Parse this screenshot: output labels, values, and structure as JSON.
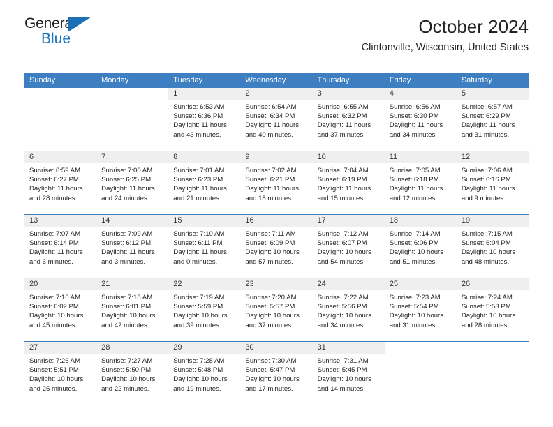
{
  "brand": {
    "name_top": "General",
    "name_bottom": "Blue",
    "accent_color": "#1d72b8"
  },
  "header": {
    "title": "October 2024",
    "location": "Clintonville, Wisconsin, United States"
  },
  "theme": {
    "header_bg": "#3d7fc1",
    "daynum_bg": "#efefef",
    "text": "#222222"
  },
  "weekday_headers": [
    "Sunday",
    "Monday",
    "Tuesday",
    "Wednesday",
    "Thursday",
    "Friday",
    "Saturday"
  ],
  "weeks": [
    [
      {
        "day": "",
        "lines": []
      },
      {
        "day": "",
        "lines": []
      },
      {
        "day": "1",
        "lines": [
          "Sunrise: 6:53 AM",
          "Sunset: 6:36 PM",
          "Daylight: 11 hours and 43 minutes."
        ]
      },
      {
        "day": "2",
        "lines": [
          "Sunrise: 6:54 AM",
          "Sunset: 6:34 PM",
          "Daylight: 11 hours and 40 minutes."
        ]
      },
      {
        "day": "3",
        "lines": [
          "Sunrise: 6:55 AM",
          "Sunset: 6:32 PM",
          "Daylight: 11 hours and 37 minutes."
        ]
      },
      {
        "day": "4",
        "lines": [
          "Sunrise: 6:56 AM",
          "Sunset: 6:30 PM",
          "Daylight: 11 hours and 34 minutes."
        ]
      },
      {
        "day": "5",
        "lines": [
          "Sunrise: 6:57 AM",
          "Sunset: 6:29 PM",
          "Daylight: 11 hours and 31 minutes."
        ]
      }
    ],
    [
      {
        "day": "6",
        "lines": [
          "Sunrise: 6:59 AM",
          "Sunset: 6:27 PM",
          "Daylight: 11 hours and 28 minutes."
        ]
      },
      {
        "day": "7",
        "lines": [
          "Sunrise: 7:00 AM",
          "Sunset: 6:25 PM",
          "Daylight: 11 hours and 24 minutes."
        ]
      },
      {
        "day": "8",
        "lines": [
          "Sunrise: 7:01 AM",
          "Sunset: 6:23 PM",
          "Daylight: 11 hours and 21 minutes."
        ]
      },
      {
        "day": "9",
        "lines": [
          "Sunrise: 7:02 AM",
          "Sunset: 6:21 PM",
          "Daylight: 11 hours and 18 minutes."
        ]
      },
      {
        "day": "10",
        "lines": [
          "Sunrise: 7:04 AM",
          "Sunset: 6:19 PM",
          "Daylight: 11 hours and 15 minutes."
        ]
      },
      {
        "day": "11",
        "lines": [
          "Sunrise: 7:05 AM",
          "Sunset: 6:18 PM",
          "Daylight: 11 hours and 12 minutes."
        ]
      },
      {
        "day": "12",
        "lines": [
          "Sunrise: 7:06 AM",
          "Sunset: 6:16 PM",
          "Daylight: 11 hours and 9 minutes."
        ]
      }
    ],
    [
      {
        "day": "13",
        "lines": [
          "Sunrise: 7:07 AM",
          "Sunset: 6:14 PM",
          "Daylight: 11 hours and 6 minutes."
        ]
      },
      {
        "day": "14",
        "lines": [
          "Sunrise: 7:09 AM",
          "Sunset: 6:12 PM",
          "Daylight: 11 hours and 3 minutes."
        ]
      },
      {
        "day": "15",
        "lines": [
          "Sunrise: 7:10 AM",
          "Sunset: 6:11 PM",
          "Daylight: 11 hours and 0 minutes."
        ]
      },
      {
        "day": "16",
        "lines": [
          "Sunrise: 7:11 AM",
          "Sunset: 6:09 PM",
          "Daylight: 10 hours and 57 minutes."
        ]
      },
      {
        "day": "17",
        "lines": [
          "Sunrise: 7:12 AM",
          "Sunset: 6:07 PM",
          "Daylight: 10 hours and 54 minutes."
        ]
      },
      {
        "day": "18",
        "lines": [
          "Sunrise: 7:14 AM",
          "Sunset: 6:06 PM",
          "Daylight: 10 hours and 51 minutes."
        ]
      },
      {
        "day": "19",
        "lines": [
          "Sunrise: 7:15 AM",
          "Sunset: 6:04 PM",
          "Daylight: 10 hours and 48 minutes."
        ]
      }
    ],
    [
      {
        "day": "20",
        "lines": [
          "Sunrise: 7:16 AM",
          "Sunset: 6:02 PM",
          "Daylight: 10 hours and 45 minutes."
        ]
      },
      {
        "day": "21",
        "lines": [
          "Sunrise: 7:18 AM",
          "Sunset: 6:01 PM",
          "Daylight: 10 hours and 42 minutes."
        ]
      },
      {
        "day": "22",
        "lines": [
          "Sunrise: 7:19 AM",
          "Sunset: 5:59 PM",
          "Daylight: 10 hours and 39 minutes."
        ]
      },
      {
        "day": "23",
        "lines": [
          "Sunrise: 7:20 AM",
          "Sunset: 5:57 PM",
          "Daylight: 10 hours and 37 minutes."
        ]
      },
      {
        "day": "24",
        "lines": [
          "Sunrise: 7:22 AM",
          "Sunset: 5:56 PM",
          "Daylight: 10 hours and 34 minutes."
        ]
      },
      {
        "day": "25",
        "lines": [
          "Sunrise: 7:23 AM",
          "Sunset: 5:54 PM",
          "Daylight: 10 hours and 31 minutes."
        ]
      },
      {
        "day": "26",
        "lines": [
          "Sunrise: 7:24 AM",
          "Sunset: 5:53 PM",
          "Daylight: 10 hours and 28 minutes."
        ]
      }
    ],
    [
      {
        "day": "27",
        "lines": [
          "Sunrise: 7:26 AM",
          "Sunset: 5:51 PM",
          "Daylight: 10 hours and 25 minutes."
        ]
      },
      {
        "day": "28",
        "lines": [
          "Sunrise: 7:27 AM",
          "Sunset: 5:50 PM",
          "Daylight: 10 hours and 22 minutes."
        ]
      },
      {
        "day": "29",
        "lines": [
          "Sunrise: 7:28 AM",
          "Sunset: 5:48 PM",
          "Daylight: 10 hours and 19 minutes."
        ]
      },
      {
        "day": "30",
        "lines": [
          "Sunrise: 7:30 AM",
          "Sunset: 5:47 PM",
          "Daylight: 10 hours and 17 minutes."
        ]
      },
      {
        "day": "31",
        "lines": [
          "Sunrise: 7:31 AM",
          "Sunset: 5:45 PM",
          "Daylight: 10 hours and 14 minutes."
        ]
      },
      {
        "day": "",
        "lines": []
      },
      {
        "day": "",
        "lines": []
      }
    ]
  ]
}
